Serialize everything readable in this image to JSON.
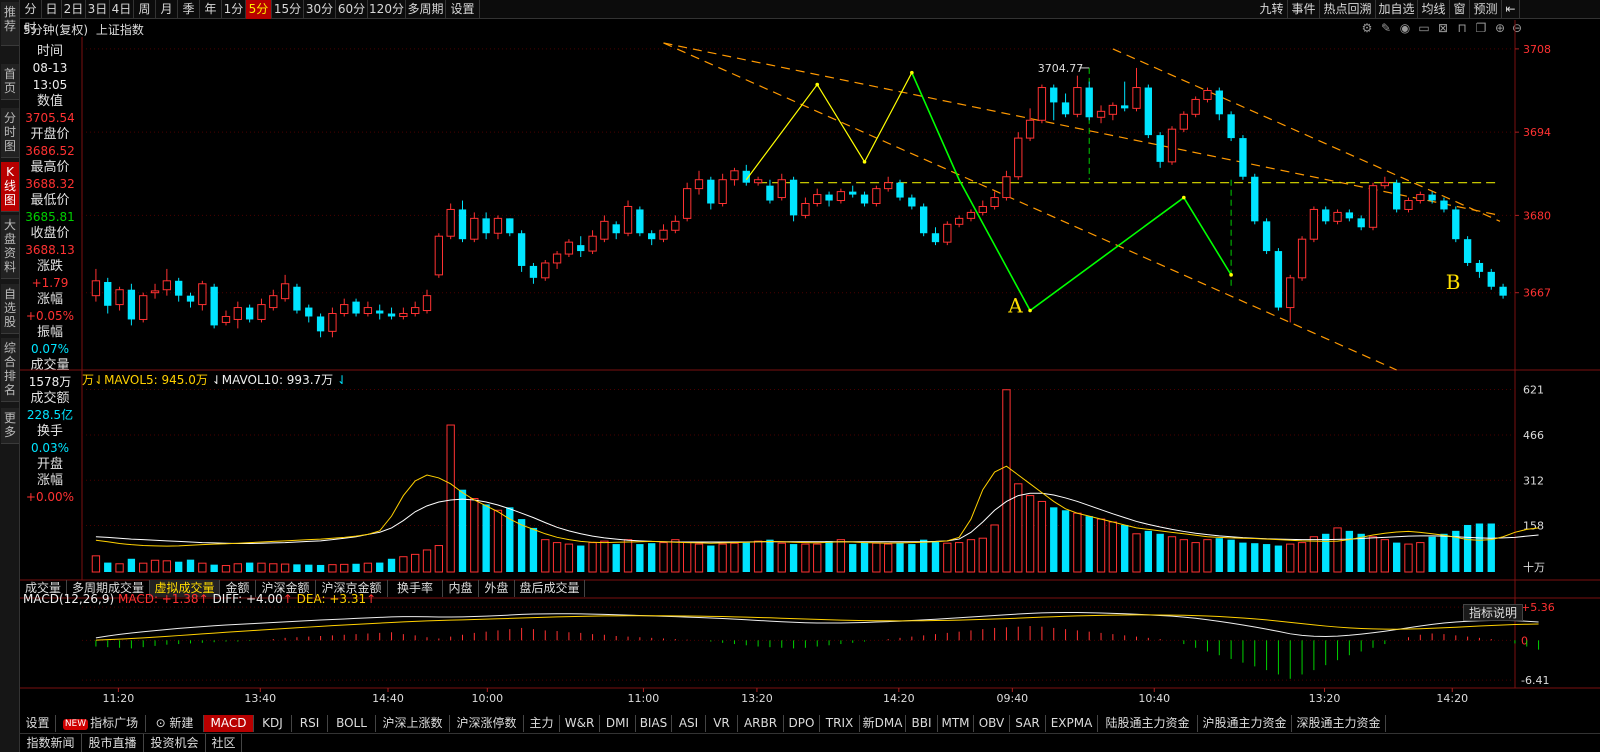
{
  "toolbar": {
    "left_items": [
      "分时",
      "日",
      "2日",
      "3日",
      "4日",
      "周",
      "月",
      "季",
      "年",
      "1分",
      "5分",
      "15分",
      "30分",
      "60分",
      "120分",
      "多周期",
      "设置"
    ],
    "active_item": "5分",
    "right_items": [
      "九转",
      "事件",
      "热点回溯",
      "加自选",
      "均线",
      "窗",
      "预测"
    ]
  },
  "sidebar": {
    "items": [
      "推荐",
      "首页",
      "分时图",
      "K线图",
      "大盘资料",
      "自选股",
      "综合排名",
      "更多"
    ],
    "active_item": "K线图"
  },
  "chart_header": {
    "period_label": "5分钟(复权)",
    "index_name": "上证指数"
  },
  "info_panel": {
    "time_label": "时间",
    "date": "08-13",
    "time": "13:05",
    "value_label": "数值",
    "value": "3705.54",
    "open_label": "开盘价",
    "open": "3686.52",
    "high_label": "最高价",
    "high": "3688.32",
    "low_label": "最低价",
    "low": "3685.81",
    "close_label": "收盘价",
    "close": "3688.13",
    "change_label": "涨跌",
    "change": "+1.79",
    "change_pct_label": "涨幅",
    "change_pct": "+0.05%",
    "amplitude_label": "振幅",
    "amplitude": "0.07%",
    "volume_label": "成交量",
    "volume": "1578万",
    "amount_label": "成交额",
    "amount": "228.5亿",
    "turnover_label": "换手",
    "turnover": "0.03%",
    "open_change_label1": "开盘",
    "open_change_label2": "涨幅",
    "open_change": "+0.00%"
  },
  "price_axis": {
    "ticks": [
      "3708",
      "3694",
      "3680",
      "3667"
    ]
  },
  "annotations": {
    "peak_label": "3704.77",
    "point_a": "A",
    "point_b": "B"
  },
  "volume_legend": {
    "unit_tail": "万",
    "ma5_label": "MAVOL5: 945.0万",
    "ma10_label": "MAVOL10: 993.7万"
  },
  "volume_axis": {
    "ticks": [
      "621",
      "466",
      "312",
      "158"
    ],
    "unit": "十万"
  },
  "volume_tabs": [
    "成交量",
    "多周期成交量",
    "虚拟成交量",
    "金额",
    "沪深金额",
    "沪深京金额",
    "换手率",
    "内盘",
    "外盘",
    "盘后成交量"
  ],
  "volume_tab_active": "虚拟成交量",
  "macd_legend": {
    "name": "MACD(12,26,9)",
    "macd": "MACD: +1.38",
    "diff": "DIFF: +4.00",
    "dea": "DEA: +3.31"
  },
  "macd_axis": {
    "ticks": [
      "+5.36",
      "0",
      "-6.41"
    ]
  },
  "explain_button": "指标说明",
  "time_axis": {
    "labels": [
      "11:20",
      "13:40",
      "14:40",
      "10:00",
      "11:00",
      "13:20",
      "14:20",
      "09:40",
      "10:40",
      "13:20",
      "14:20"
    ]
  },
  "indicator_tabs": {
    "settings": "设置",
    "new_badge": "NEW",
    "items": [
      "指标广场",
      "新建",
      "MACD",
      "KDJ",
      "RSI",
      "BOLL",
      "沪深上涨数",
      "沪深涨停数",
      "主力",
      "W&R",
      "DMI",
      "BIAS",
      "ASI",
      "VR",
      "ARBR",
      "DPO",
      "TRIX",
      "新DMA",
      "BBI",
      "MTM",
      "OBV",
      "SAR",
      "EXPMA",
      "陆股通主力资金",
      "沪股通主力资金",
      "深股通主力资金"
    ],
    "active": "MACD"
  },
  "bottom_tabs": [
    "指数新闻",
    "股市直播",
    "投资机会",
    "社区"
  ],
  "colors": {
    "up": "#ff3232",
    "down": "#00e5ff",
    "trend": "#ff9900",
    "wave_yellow": "#ffff00",
    "wave_green": "#00ff00",
    "ma5": "#ffd000",
    "ma10": "#ffffff"
  },
  "chart_data": {
    "type": "candlestick",
    "title": "上证指数",
    "period": "5分钟",
    "ylim": [
      3654,
      3710
    ],
    "candles": [
      [
        3666.5,
        3669.0,
        3671.0,
        3665.5
      ],
      [
        3668.8,
        3664.8,
        3669.5,
        3663.5
      ],
      [
        3665.0,
        3667.5,
        3668.0,
        3664.0
      ],
      [
        3667.5,
        3662.5,
        3668.5,
        3661.5
      ],
      [
        3662.5,
        3666.5,
        3667.0,
        3662.0
      ],
      [
        3667.0,
        3667.3,
        3668.5,
        3666.0
      ],
      [
        3667.5,
        3669.0,
        3671.0,
        3666.5
      ],
      [
        3669.0,
        3666.5,
        3669.5,
        3665.5
      ],
      [
        3666.5,
        3665.5,
        3667.0,
        3664.5
      ],
      [
        3665.0,
        3668.5,
        3669.0,
        3664.0
      ],
      [
        3668.0,
        3661.5,
        3668.5,
        3661.0
      ],
      [
        3662.0,
        3663.0,
        3664.0,
        3661.5
      ],
      [
        3662.5,
        3664.5,
        3665.5,
        3661.0
      ],
      [
        3664.5,
        3662.5,
        3665.0,
        3662.0
      ],
      [
        3662.5,
        3665.0,
        3666.0,
        3662.0
      ],
      [
        3664.5,
        3666.5,
        3667.5,
        3664.0
      ],
      [
        3666.0,
        3668.5,
        3670.0,
        3665.5
      ],
      [
        3668.0,
        3664.0,
        3668.5,
        3663.5
      ],
      [
        3664.5,
        3663.0,
        3665.0,
        3662.0
      ],
      [
        3663.0,
        3660.5,
        3663.5,
        3659.5
      ],
      [
        3660.5,
        3663.5,
        3664.5,
        3659.5
      ],
      [
        3663.5,
        3665.0,
        3666.0,
        3663.0
      ],
      [
        3665.5,
        3663.5,
        3666.0,
        3663.0
      ],
      [
        3663.5,
        3664.5,
        3665.5,
        3663.0
      ],
      [
        3664.0,
        3663.5,
        3665.0,
        3662.5
      ],
      [
        3663.5,
        3663.0,
        3664.5,
        3662.5
      ],
      [
        3663.0,
        3663.5,
        3664.5,
        3662.5
      ],
      [
        3663.5,
        3664.5,
        3665.5,
        3663.0
      ],
      [
        3664.0,
        3666.5,
        3667.5,
        3663.5
      ],
      [
        3670.0,
        3676.5,
        3677.0,
        3669.5
      ],
      [
        3676.5,
        3681.0,
        3682.0,
        3676.0
      ],
      [
        3681.0,
        3676.0,
        3682.5,
        3675.5
      ],
      [
        3676.0,
        3679.5,
        3680.5,
        3675.5
      ],
      [
        3679.5,
        3677.0,
        3680.5,
        3676.0
      ],
      [
        3677.0,
        3679.5,
        3680.0,
        3676.0
      ],
      [
        3679.5,
        3677.0,
        3679.5,
        3676.5
      ],
      [
        3677.0,
        3671.5,
        3677.5,
        3670.5
      ],
      [
        3671.5,
        3669.5,
        3672.0,
        3668.5
      ],
      [
        3669.5,
        3672.0,
        3672.5,
        3669.0
      ],
      [
        3672.0,
        3673.5,
        3674.0,
        3671.0
      ],
      [
        3673.5,
        3675.5,
        3676.0,
        3673.0
      ],
      [
        3675.0,
        3674.0,
        3676.5,
        3673.0
      ],
      [
        3674.0,
        3676.5,
        3677.5,
        3673.5
      ],
      [
        3676.0,
        3679.0,
        3680.0,
        3675.5
      ],
      [
        3678.5,
        3677.0,
        3679.0,
        3676.0
      ],
      [
        3677.0,
        3681.5,
        3682.5,
        3676.5
      ],
      [
        3681.0,
        3677.0,
        3681.5,
        3676.5
      ],
      [
        3677.0,
        3676.0,
        3677.5,
        3675.0
      ],
      [
        3676.0,
        3677.5,
        3678.5,
        3675.5
      ],
      [
        3677.5,
        3679.0,
        3680.0,
        3677.0
      ],
      [
        3679.5,
        3684.5,
        3685.5,
        3679.0
      ],
      [
        3684.5,
        3686.0,
        3687.5,
        3683.5
      ],
      [
        3686.0,
        3682.0,
        3686.5,
        3681.0
      ],
      [
        3682.0,
        3686.0,
        3687.0,
        3681.5
      ],
      [
        3686.0,
        3687.5,
        3688.0,
        3685.0
      ],
      [
        3687.5,
        3685.5,
        3688.5,
        3685.0
      ],
      [
        3685.5,
        3686.0,
        3686.5,
        3685.0
      ],
      [
        3685.0,
        3682.5,
        3686.0,
        3682.0
      ],
      [
        3683.0,
        3686.0,
        3687.0,
        3682.5
      ],
      [
        3686.0,
        3680.0,
        3686.5,
        3679.0
      ],
      [
        3680.0,
        3682.0,
        3683.0,
        3679.5
      ],
      [
        3682.0,
        3683.5,
        3684.5,
        3681.5
      ],
      [
        3683.5,
        3682.5,
        3684.0,
        3681.5
      ],
      [
        3682.5,
        3684.0,
        3684.5,
        3682.0
      ],
      [
        3684.0,
        3683.5,
        3685.0,
        3683.0
      ],
      [
        3683.5,
        3682.0,
        3684.0,
        3681.5
      ],
      [
        3682.0,
        3684.5,
        3685.0,
        3681.5
      ],
      [
        3684.5,
        3685.5,
        3686.5,
        3684.0
      ],
      [
        3685.5,
        3683.0,
        3686.0,
        3682.5
      ],
      [
        3683.0,
        3681.5,
        3683.5,
        3681.0
      ],
      [
        3681.5,
        3677.0,
        3682.0,
        3676.5
      ],
      [
        3677.0,
        3675.5,
        3678.0,
        3675.0
      ],
      [
        3675.5,
        3678.5,
        3679.0,
        3675.0
      ],
      [
        3678.5,
        3679.5,
        3680.0,
        3678.0
      ],
      [
        3679.5,
        3680.5,
        3681.0,
        3679.0
      ],
      [
        3680.5,
        3681.5,
        3682.5,
        3680.0
      ],
      [
        3681.5,
        3683.0,
        3684.0,
        3681.0
      ],
      [
        3683.0,
        3686.5,
        3687.5,
        3682.5
      ],
      [
        3686.5,
        3693.0,
        3694.0,
        3686.0
      ],
      [
        3693.0,
        3696.0,
        3698.0,
        3692.5
      ],
      [
        3696.0,
        3701.5,
        3702.0,
        3695.5
      ],
      [
        3701.5,
        3699.0,
        3702.0,
        3696.0
      ],
      [
        3699.0,
        3697.0,
        3700.5,
        3696.5
      ],
      [
        3697.0,
        3701.5,
        3703.5,
        3696.5
      ],
      [
        3701.5,
        3696.5,
        3702.5,
        3696.0
      ],
      [
        3696.5,
        3697.5,
        3698.5,
        3695.5
      ],
      [
        3697.0,
        3698.5,
        3699.0,
        3696.0
      ],
      [
        3698.5,
        3698.0,
        3702.5,
        3697.5
      ],
      [
        3698.0,
        3701.5,
        3704.8,
        3697.5
      ],
      [
        3701.5,
        3693.5,
        3702.0,
        3693.0
      ],
      [
        3693.5,
        3689.0,
        3694.0,
        3688.0
      ],
      [
        3689.0,
        3694.5,
        3695.0,
        3688.5
      ],
      [
        3694.5,
        3697.0,
        3697.5,
        3694.0
      ],
      [
        3697.0,
        3699.5,
        3700.0,
        3696.5
      ],
      [
        3699.5,
        3701.0,
        3701.5,
        3699.0
      ],
      [
        3701.0,
        3697.0,
        3701.5,
        3696.0
      ],
      [
        3697.0,
        3693.0,
        3697.5,
        3692.5
      ],
      [
        3693.0,
        3686.5,
        3693.5,
        3686.0
      ],
      [
        3686.5,
        3679.0,
        3687.0,
        3678.5
      ],
      [
        3679.0,
        3674.0,
        3679.5,
        3673.5
      ],
      [
        3674.0,
        3664.5,
        3674.5,
        3664.0
      ],
      [
        3664.5,
        3669.5,
        3670.0,
        3662.0
      ],
      [
        3669.5,
        3676.0,
        3676.5,
        3669.0
      ],
      [
        3676.0,
        3681.0,
        3681.5,
        3675.5
      ],
      [
        3681.0,
        3679.0,
        3681.5,
        3678.5
      ],
      [
        3679.0,
        3680.5,
        3681.0,
        3678.5
      ],
      [
        3680.5,
        3679.5,
        3681.0,
        3679.0
      ],
      [
        3679.5,
        3678.0,
        3680.0,
        3677.5
      ],
      [
        3678.0,
        3685.0,
        3685.5,
        3677.5
      ],
      [
        3685.0,
        3685.5,
        3686.5,
        3684.5
      ],
      [
        3685.5,
        3681.0,
        3686.0,
        3680.5
      ],
      [
        3681.0,
        3682.5,
        3683.0,
        3680.5
      ],
      [
        3682.5,
        3683.5,
        3684.0,
        3682.0
      ],
      [
        3683.5,
        3682.5,
        3684.0,
        3682.0
      ],
      [
        3682.5,
        3681.0,
        3683.0,
        3680.5
      ],
      [
        3681.0,
        3676.0,
        3681.5,
        3675.5
      ],
      [
        3676.0,
        3672.0,
        3676.5,
        3671.5
      ],
      [
        3672.0,
        3670.5,
        3672.5,
        3669.5
      ],
      [
        3670.5,
        3668.0,
        3671.0,
        3667.5
      ],
      [
        3668.0,
        3666.5,
        3668.5,
        3666.0
      ]
    ],
    "volume_ticks": [
      621,
      466,
      312,
      158
    ],
    "volume": [
      55,
      32,
      28,
      45,
      30,
      40,
      38,
      35,
      42,
      30,
      25,
      22,
      28,
      32,
      30,
      28,
      27,
      26,
      25,
      24,
      25,
      26,
      28,
      30,
      32,
      45,
      52,
      60,
      75,
      90,
      500,
      280,
      250,
      230,
      210,
      220,
      180,
      150,
      110,
      100,
      95,
      90,
      100,
      105,
      95,
      110,
      95,
      98,
      100,
      110,
      102,
      95,
      90,
      95,
      98,
      100,
      105,
      110,
      98,
      95,
      95,
      95,
      105,
      110,
      95,
      100,
      98,
      95,
      100,
      95,
      110,
      105,
      98,
      100,
      110,
      115,
      160,
      620,
      300,
      260,
      240,
      220,
      210,
      200,
      190,
      180,
      170,
      160,
      130,
      140,
      130,
      120,
      110,
      100,
      110,
      115,
      110,
      100,
      98,
      95,
      90,
      95,
      100,
      120,
      130,
      150,
      140,
      130,
      120,
      110,
      100,
      95,
      100,
      120,
      130,
      140,
      160,
      165,
      165
    ],
    "macd_ticks": [
      5.36,
      0,
      -6.41
    ],
    "macd": [
      -1,
      -1.1,
      -1.2,
      -1.3,
      -1.1,
      -0.9,
      -0.7,
      -0.6,
      -0.5,
      -0.4,
      -0.3,
      -0.2,
      -0.2,
      -0.1,
      0,
      0.2,
      0.4,
      0.5,
      0.6,
      0.7,
      0.8,
      0.9,
      1.0,
      1.1,
      1.2,
      1.3,
      1.0,
      0.8,
      0.5,
      0.3,
      0.6,
      0.9,
      1.2,
      1.4,
      1.6,
      1.8,
      2.0,
      1.8,
      1.6,
      1.5,
      1.3,
      1.2,
      1.0,
      0.9,
      0.7,
      0.6,
      0.5,
      0.4,
      0.3,
      0.2,
      0.1,
      0,
      -0.2,
      -0.4,
      -0.6,
      -0.8,
      -1.0,
      -1.1,
      -1.2,
      -1.3,
      -1.2,
      -1.0,
      -0.8,
      -0.6,
      -0.4,
      -0.2,
      0,
      0.2,
      0.4,
      0.6,
      0.8,
      1.0,
      1.2,
      1.4,
      1.6,
      1.8,
      2.0,
      2.1,
      2.2,
      2.3,
      2.2,
      2.0,
      1.8,
      1.6,
      1.4,
      1.2,
      1.0,
      0.8,
      0.6,
      0.4,
      0.2,
      0,
      -0.6,
      -1.2,
      -1.8,
      -2.4,
      -3.0,
      -3.6,
      -4.2,
      -4.8,
      -5.5,
      -6.2,
      -5.5,
      -4.8,
      -4.0,
      -3.2,
      -2.4,
      -1.8,
      -1.2,
      -0.6,
      0,
      0.5,
      0.9,
      1.1,
      1.0,
      0.8,
      0.6,
      0.4,
      0.2,
      0,
      -0.5,
      -1.0,
      -1.5
    ],
    "ma5": [
      108,
      103,
      97,
      93,
      90,
      89,
      88,
      89,
      91,
      93,
      95,
      96,
      98,
      100,
      102,
      104,
      106,
      108,
      110,
      112,
      115,
      118,
      122,
      128,
      140,
      190,
      260,
      310,
      330,
      320,
      300,
      270,
      245,
      225,
      205,
      180,
      160,
      145,
      130,
      118,
      110,
      104,
      101,
      100,
      101,
      102,
      103,
      104,
      103,
      101,
      100,
      99,
      98,
      99,
      100,
      101,
      103,
      104,
      103,
      101,
      100,
      99,
      101,
      103,
      102,
      100,
      99,
      98,
      99,
      100,
      101,
      103,
      106,
      118,
      180,
      280,
      340,
      360,
      330,
      300,
      270,
      240,
      215,
      200,
      190,
      180,
      170,
      160,
      150,
      145,
      140,
      135,
      130,
      125,
      120,
      118,
      116,
      115,
      114,
      112,
      110,
      108,
      106,
      105,
      104,
      105,
      110,
      118,
      126,
      132,
      136,
      138,
      135,
      130,
      125,
      118,
      110,
      108,
      110,
      120,
      135,
      145,
      150
    ],
    "ma10": [
      120,
      118,
      115,
      112,
      110,
      108,
      106,
      104,
      102,
      100,
      99,
      98,
      97,
      97,
      98,
      99,
      100,
      102,
      104,
      106,
      110,
      115,
      120,
      128,
      135,
      150,
      175,
      205,
      225,
      238,
      245,
      248,
      245,
      238,
      228,
      215,
      200,
      185,
      168,
      152,
      140,
      130,
      122,
      116,
      112,
      108,
      106,
      104,
      103,
      102,
      102,
      102,
      102,
      102,
      102,
      102,
      103,
      103,
      103,
      103,
      103,
      103,
      103,
      103,
      103,
      103,
      103,
      103,
      103,
      103,
      103,
      104,
      106,
      112,
      135,
      170,
      210,
      240,
      260,
      268,
      268,
      262,
      252,
      240,
      226,
      212,
      198,
      185,
      172,
      162,
      153,
      145,
      138,
      132,
      127,
      123,
      120,
      117,
      115,
      113,
      112,
      111,
      110,
      110,
      110,
      111,
      112,
      114,
      116,
      118,
      120,
      122,
      123,
      123,
      122,
      120,
      118,
      116,
      115,
      116,
      118,
      122,
      126
    ]
  }
}
